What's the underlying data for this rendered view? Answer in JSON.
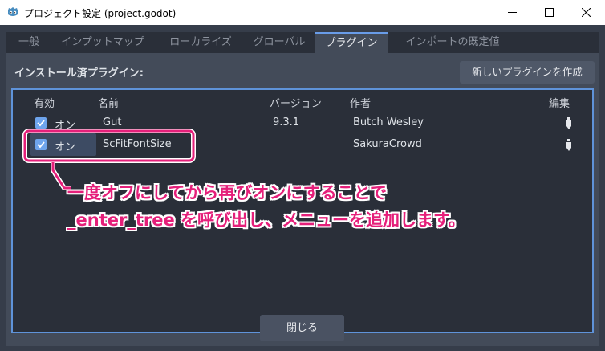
{
  "window": {
    "title": "プロジェクト設定 (project.godot)",
    "app_icon": "godot-icon",
    "controls": [
      "minimize-icon",
      "maximize-icon",
      "close-icon"
    ]
  },
  "tabs": [
    {
      "label": "一般",
      "active": false
    },
    {
      "label": "インプットマップ",
      "active": false
    },
    {
      "label": "ローカライズ",
      "active": false
    },
    {
      "label": "グローバル",
      "active": false
    },
    {
      "label": "プラグイン",
      "active": true
    },
    {
      "label": "インポートの既定値",
      "active": false
    }
  ],
  "plugins": {
    "section_title": "インストール済プラグイン:",
    "create_button": "新しいプラグインを作成",
    "columns": {
      "enabled": "有効",
      "name": "名前",
      "version": "バージョン",
      "author": "作者",
      "edit": "編集"
    },
    "rows": [
      {
        "enabled": true,
        "status": "オン",
        "name": "Gut",
        "version": "9.3.1",
        "author": "Butch Wesley",
        "edit_icon": "edit-icon"
      },
      {
        "enabled": true,
        "status": "オン",
        "name": "ScFitFontSize",
        "version": "",
        "author": "SakuraCrowd",
        "edit_icon": "edit-icon"
      }
    ]
  },
  "close_button": "閉じる",
  "annotation": {
    "line1": "一度オフにしてから再びオンにすることで",
    "line2": "_enter_tree を呼び出し、メニューを追加します。",
    "color": "#e51f7a"
  },
  "colors": {
    "accent": "#699ce8",
    "panel": "#434b59",
    "tree_bg": "#2a2f39",
    "annotation": "#e51f7a"
  }
}
